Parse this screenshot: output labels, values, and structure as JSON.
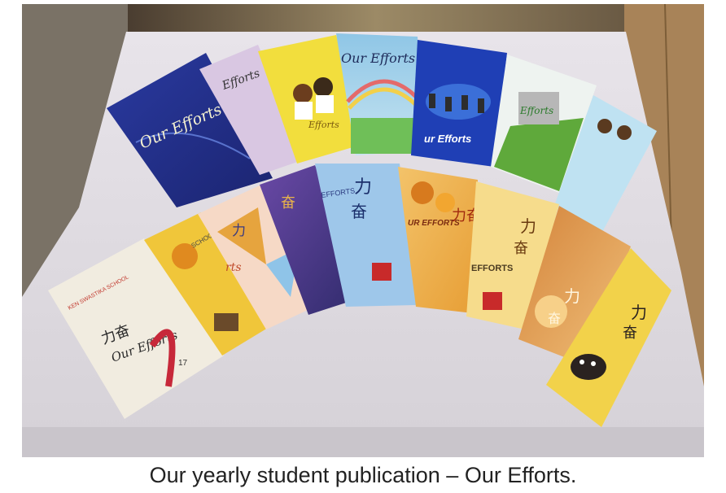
{
  "caption": "Our yearly student publication – Our Efforts.",
  "photo": {
    "cover_texts": {
      "title_en": "Our Efforts",
      "title_en_b": "Efforts",
      "title_en_c": "Our Efforts",
      "title_en_d": "ur Efforts",
      "title_cn": "力奋",
      "title_cn_a": "力",
      "title_cn_b": "奋",
      "efforts_caps": "EFFORTS",
      "ur_efforts_caps": "UR EFFORTS",
      "school": "KEN SWASTIKA SCHOOL",
      "issue": "17",
      "frag_school": "SCHOOL",
      "frag_rts": "rts"
    }
  }
}
